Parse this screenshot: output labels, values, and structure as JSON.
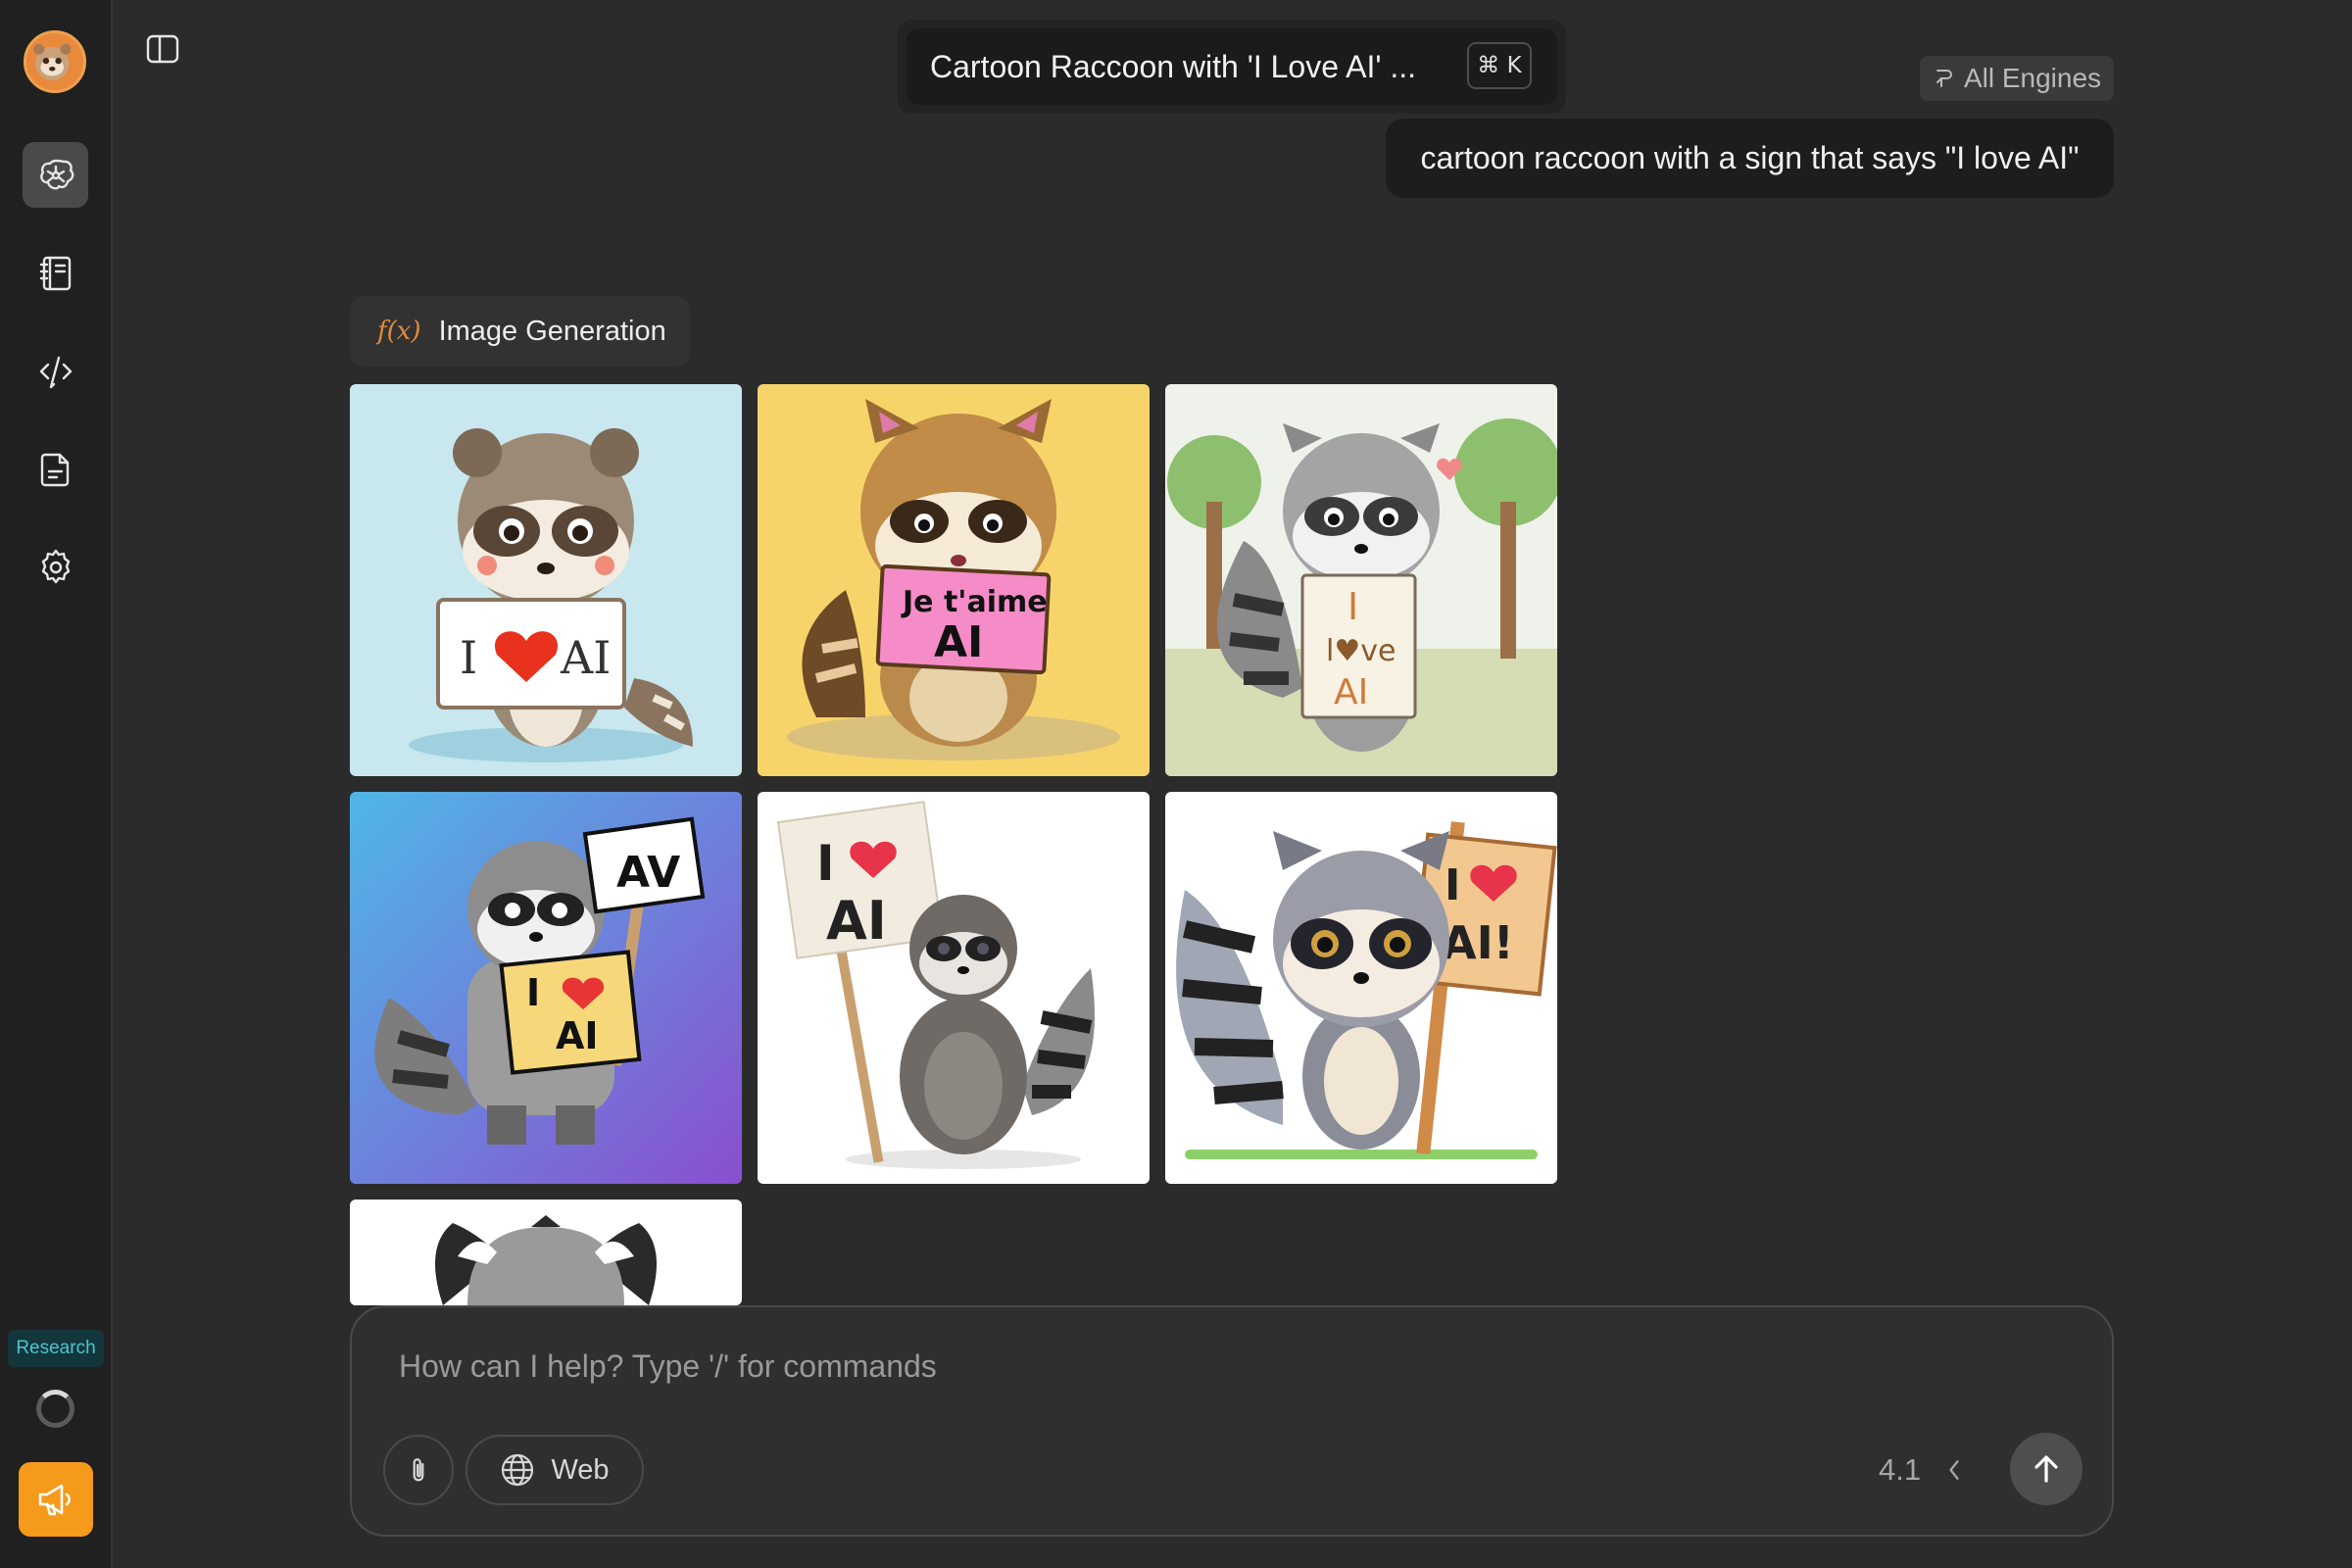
{
  "sidebar": {
    "items": [
      {
        "name": "assistant",
        "icon": "brain-network-icon",
        "active": true
      },
      {
        "name": "notebook",
        "icon": "notebook-icon",
        "active": false
      },
      {
        "name": "code",
        "icon": "code-pen-icon",
        "active": false
      },
      {
        "name": "documents",
        "icon": "document-icon",
        "active": false
      },
      {
        "name": "settings",
        "icon": "gear-icon",
        "active": false
      }
    ],
    "research_label": "Research",
    "accent_color": "#f59a1b"
  },
  "header": {
    "title": "Cartoon Raccoon with 'I Love AI' ...",
    "shortcut": "⌘ K",
    "engines_label": "All Engines"
  },
  "chat": {
    "user_message": "cartoon raccoon with a sign that says \"I love AI\"",
    "tool_label": "Image Generation",
    "tool_icon": "f(x)",
    "images": [
      {
        "sign_text": "I ♥ AI",
        "background": "#c9e7ef"
      },
      {
        "sign_text": "Je t'aime AI",
        "background": "#f7d46a"
      },
      {
        "sign_text": "I l♥ve AI",
        "background": "#e9efe0"
      },
      {
        "sign_text": "AV / I ♥ AI",
        "background": "#5a8fe0"
      },
      {
        "sign_text": "I ♥ AI",
        "background": "#ffffff"
      },
      {
        "sign_text": "I ♥ AI!",
        "background": "#ffffff"
      },
      {
        "sign_text": "",
        "background": "#ffffff"
      }
    ]
  },
  "composer": {
    "placeholder": "How can I help? Type '/' for commands",
    "web_label": "Web",
    "version": "4.1"
  }
}
